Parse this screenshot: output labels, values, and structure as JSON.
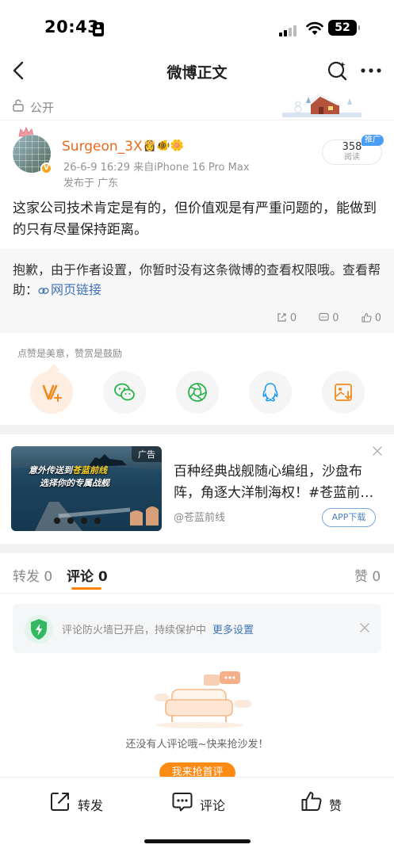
{
  "status_bar": {
    "time": "20:43",
    "battery": "52"
  },
  "nav": {
    "title": "微博正文"
  },
  "visibility": {
    "label": "公开"
  },
  "author": {
    "name": "Surgeon_3X",
    "badges": "👸🐠🌼",
    "meta": "26-6-9 16:29   来自iPhone 16 Pro Max",
    "location": "发布于 广东",
    "verified_mark": "V"
  },
  "read_count": {
    "number": "358",
    "label": "阅读",
    "promo_tag": "推广"
  },
  "post": {
    "text": "这家公司技术肯定是有的，但价值观是有严重问题的，能做到的只有尽量保持距离。"
  },
  "repost": {
    "notice": "抱歉，由于作者设置，你暂时没有这条微博的查看权限哦。查看帮助：",
    "link_text": "网页链接",
    "stats": {
      "reposts": "0",
      "comments": "0",
      "likes": "0"
    }
  },
  "reward": {
    "hint": "点赞是美意，赞赏是鼓励"
  },
  "share_targets": [
    {
      "icon": "reward-icon"
    },
    {
      "icon": "wechat-icon"
    },
    {
      "icon": "moments-icon"
    },
    {
      "icon": "qq-icon"
    },
    {
      "icon": "save-image-icon"
    }
  ],
  "ad": {
    "tag": "广告",
    "image_caption_1": "意外传送到",
    "image_caption_1_highlight": "苍蓝前线",
    "image_caption_2": "选择你的专属战舰",
    "text": "百种经典战舰随心编组，沙盘布阵，角逐大洋制海权！#苍蓝前…",
    "source": "@苍蓝前线",
    "download_label": "APP下载"
  },
  "tabs": {
    "repost": {
      "label": "转发",
      "count": "0"
    },
    "comment": {
      "label": "评论",
      "count": "0"
    },
    "like": {
      "label": "赞",
      "count": "0"
    }
  },
  "firewall": {
    "text": "评论防火墙已开启，持续保护中",
    "link": "更多设置"
  },
  "empty_state": {
    "text": "还没有人评论哦~快来抢沙发！",
    "button": "我来抢首评"
  },
  "bottom_bar": {
    "repost": "转发",
    "comment": "评论",
    "like": "赞"
  },
  "colors": {
    "accent": "#ff8200",
    "link": "#3f73b6",
    "username": "#e86b1d"
  }
}
